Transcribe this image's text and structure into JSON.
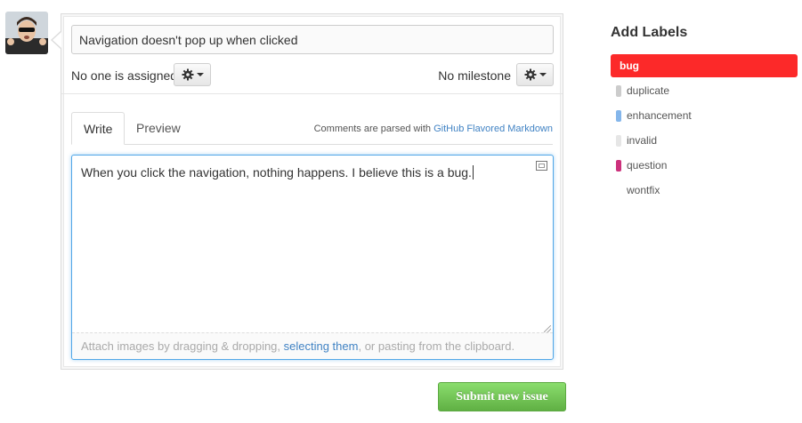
{
  "issue_form": {
    "title_value": "Navigation doesn't pop up when clicked",
    "assignee_text": "No one is assigned",
    "milestone_text": "No milestone",
    "tabs": [
      {
        "label": "Write",
        "active": true
      },
      {
        "label": "Preview",
        "active": false
      }
    ],
    "markdown_note_prefix": "Comments are parsed with ",
    "markdown_link": "GitHub Flavored Markdown",
    "body_text": "When you click the navigation, nothing happens. I believe this is a bug.",
    "attach_prefix": "Attach images by dragging & dropping, ",
    "attach_link": "selecting them",
    "attach_suffix": ", or pasting from the clipboard.",
    "submit_label": "Submit new issue"
  },
  "labels_panel": {
    "title": "Add Labels",
    "items": [
      {
        "name": "bug",
        "color": "#fc2929",
        "selected": true
      },
      {
        "name": "duplicate",
        "color": "#cccccc",
        "selected": false
      },
      {
        "name": "enhancement",
        "color": "#84b6eb",
        "selected": false
      },
      {
        "name": "invalid",
        "color": "#e6e6e6",
        "selected": false
      },
      {
        "name": "question",
        "color": "#cc317c",
        "selected": false
      },
      {
        "name": "wontfix",
        "color": "#ffffff",
        "selected": false
      }
    ]
  },
  "icons": {
    "assignee_gear": "gear-icon",
    "milestone_gear": "gear-icon",
    "fullscreen": "fullscreen-icon",
    "avatar": "user-avatar"
  }
}
